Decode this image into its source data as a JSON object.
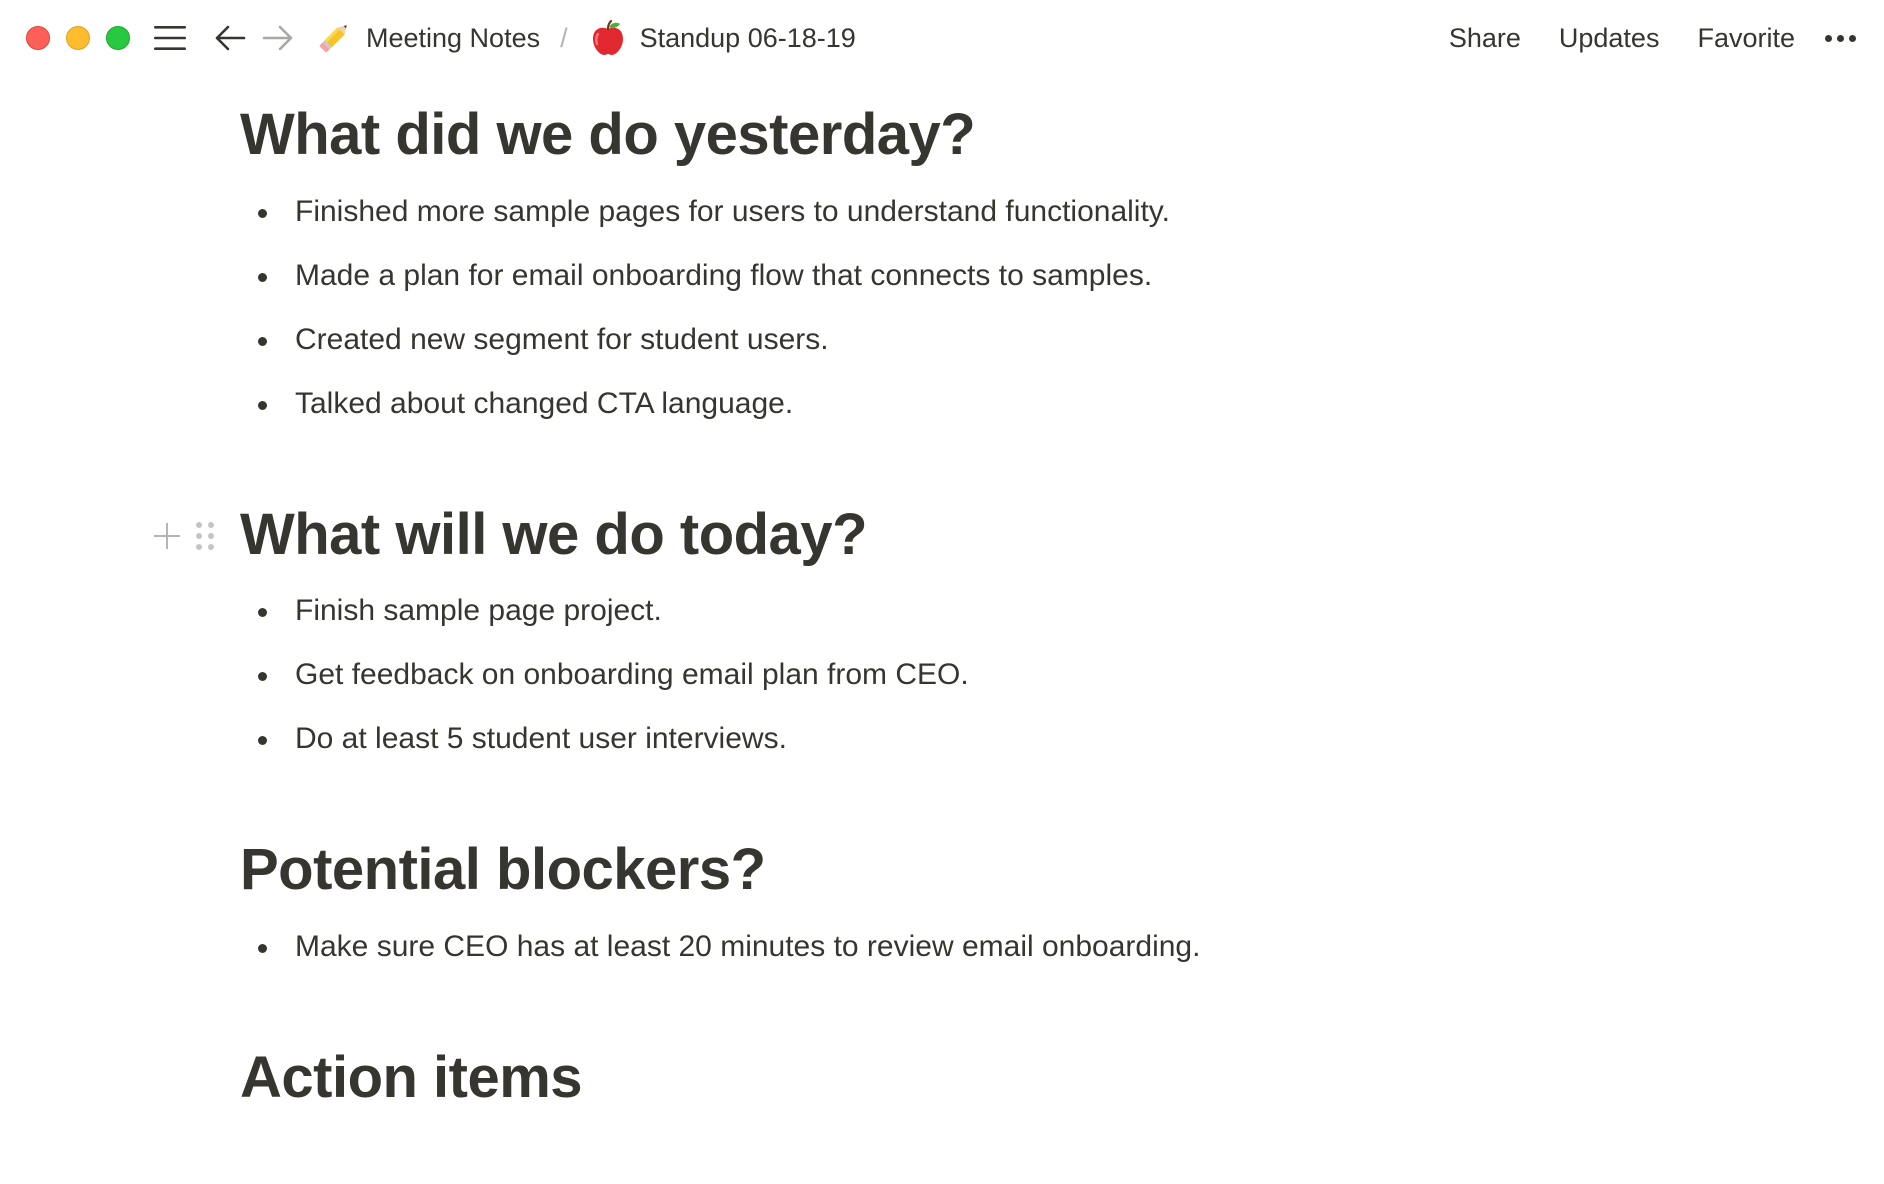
{
  "window": {
    "traffic_lights": [
      "close",
      "minimize",
      "zoom"
    ]
  },
  "topbar": {
    "icons": {
      "menu": "hamburger-menu-icon",
      "back": "arrow-left-icon",
      "forward": "arrow-right-icon"
    },
    "breadcrumb": [
      {
        "emoji": "✏️",
        "label": "Meeting Notes"
      },
      {
        "emoji": "🍎",
        "label": "Standup 06-18-19"
      }
    ],
    "separator": "/",
    "actions": {
      "share": "Share",
      "updates": "Updates",
      "favorite": "Favorite"
    }
  },
  "sections": [
    {
      "heading": "What did we do yesterday?",
      "items": [
        "Finished more sample pages for users to understand functionality.",
        "Made a plan for email onboarding flow that connects to samples.",
        "Created new segment for student users.",
        "Talked about changed CTA language."
      ]
    },
    {
      "heading": "What will we do today?",
      "items": [
        "Finish sample page project.",
        "Get feedback on onboarding email plan from CEO.",
        "Do at least 5 student user interviews."
      ]
    },
    {
      "heading": "Potential blockers?",
      "items": [
        "Make sure CEO has at least 20 minutes to review email onboarding."
      ]
    },
    {
      "heading": "Action items",
      "items": []
    }
  ],
  "colors": {
    "text": "#37352f",
    "muted": "#b4b4b0",
    "close": "#fe5f57",
    "minimize": "#febc2e",
    "zoom": "#28c840"
  }
}
